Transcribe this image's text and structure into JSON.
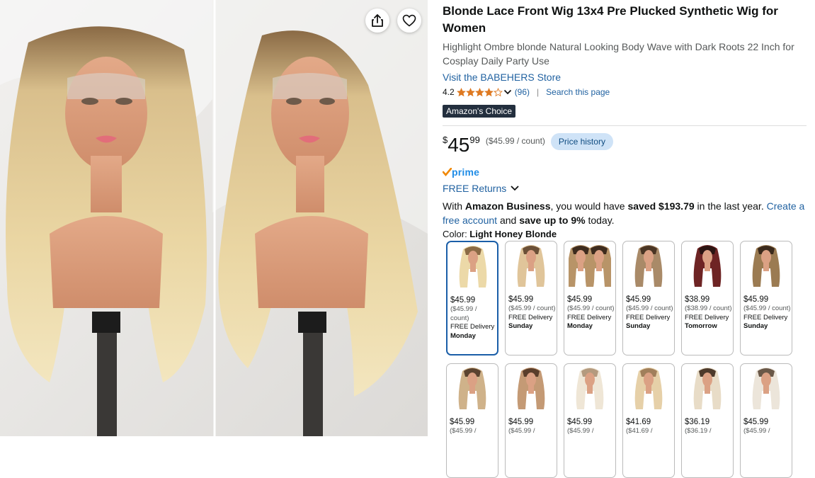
{
  "gallery": {
    "share_icon": "share-icon",
    "wishlist_icon": "heart-icon"
  },
  "product": {
    "title": "Blonde Lace Front Wig 13x4 Pre Plucked Synthetic Wig for Women",
    "subtitle": "Highlight Ombre blonde Natural Looking Body Wave with Dark Roots 22 Inch for Cosplay Daily Party Use",
    "store_link": "Visit the BABEHERS Store",
    "rating": "4.2",
    "rating_value": 4.2,
    "review_count": "(96)",
    "search_page": "Search this page",
    "badge": "Amazon's Choice"
  },
  "price": {
    "currency": "$",
    "whole": "45",
    "fraction": "99",
    "unit_price": "($45.99 / count)",
    "history_button": "Price history"
  },
  "delivery": {
    "prime": "prime",
    "returns": "FREE Returns"
  },
  "business": {
    "p1": "With ",
    "amazon_business": "Amazon Business",
    "p2": ", you would have ",
    "saved": "saved $193.79",
    "p3": " in the last year. ",
    "create_link": "Create a free account",
    "p4": " and ",
    "save_upto": "save up to 9%",
    "p5": " today."
  },
  "color": {
    "label": "Color: ",
    "value": "Light Honey Blonde"
  },
  "swatches": [
    {
      "price": "$45.99",
      "unit": "($45.99 / count)",
      "delivery": "FREE Delivery",
      "day": "Monday"
    },
    {
      "price": "$45.99",
      "unit": "($45.99 / count)",
      "delivery": "FREE Delivery",
      "day": "Sunday"
    },
    {
      "price": "$45.99",
      "unit": "($45.99 / count)",
      "delivery": "FREE Delivery",
      "day": "Monday"
    },
    {
      "price": "$45.99",
      "unit": "($45.99 / count)",
      "delivery": "FREE Delivery",
      "day": "Sunday"
    },
    {
      "price": "$38.99",
      "unit": "($38.99 / count)",
      "delivery": "FREE Delivery",
      "day": "Tomorrow"
    },
    {
      "price": "$45.99",
      "unit": "($45.99 / count)",
      "delivery": "FREE Delivery",
      "day": "Sunday"
    },
    {
      "price": "$45.99",
      "unit": "($45.99 /",
      "delivery": "",
      "day": ""
    },
    {
      "price": "$45.99",
      "unit": "($45.99 /",
      "delivery": "",
      "day": ""
    },
    {
      "price": "$45.99",
      "unit": "($45.99 /",
      "delivery": "",
      "day": ""
    },
    {
      "price": "$41.69",
      "unit": "($41.69 /",
      "delivery": "",
      "day": ""
    },
    {
      "price": "$36.19",
      "unit": "($36.19 /",
      "delivery": "",
      "day": ""
    },
    {
      "price": "$45.99",
      "unit": "($45.99 /",
      "delivery": "",
      "day": ""
    }
  ],
  "colors": {
    "link": "#2162a1",
    "star": "#de7921",
    "selected_border": "#1a5ea8",
    "badge_bg": "#232f3e",
    "prime_blue": "#1f8ce6"
  }
}
